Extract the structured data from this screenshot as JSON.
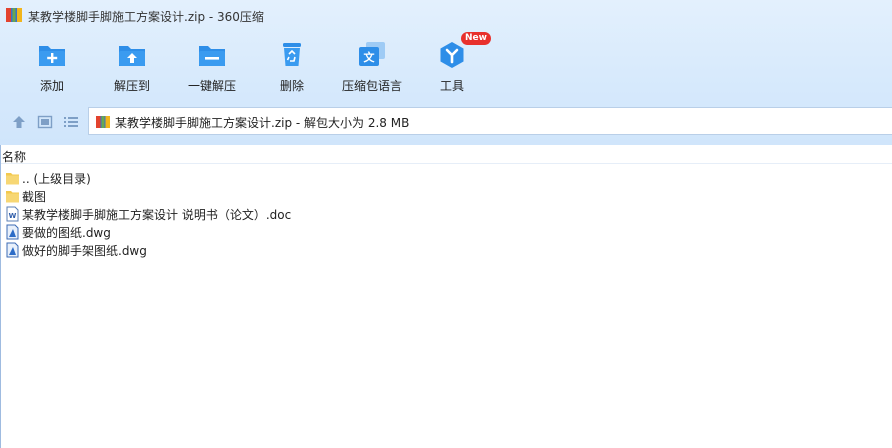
{
  "window": {
    "title": "某教学楼脚手脚施工方案设计.zip - 360压缩"
  },
  "toolbar": {
    "items": [
      {
        "label": "添加",
        "icon": "add-icon"
      },
      {
        "label": "解压到",
        "icon": "extract-to-icon"
      },
      {
        "label": "一键解压",
        "icon": "one-click-extract-icon"
      },
      {
        "label": "删除",
        "icon": "delete-icon"
      },
      {
        "label": "压缩包语言",
        "icon": "language-icon"
      },
      {
        "label": "工具",
        "icon": "tools-icon",
        "badge": "New"
      }
    ]
  },
  "address": {
    "path": "某教学楼脚手脚施工方案设计.zip - 解包大小为 2.8 MB"
  },
  "list": {
    "column_name": "名称",
    "rows": [
      {
        "name": ".. (上级目录)",
        "type": "folder"
      },
      {
        "name": "截图",
        "type": "folder"
      },
      {
        "name": "某教学楼脚手脚施工方案设计 说明书（论文）.doc",
        "type": "doc"
      },
      {
        "name": "要做的图纸.dwg",
        "type": "dwg"
      },
      {
        "name": "做好的脚手架图纸.dwg",
        "type": "dwg"
      }
    ]
  },
  "colors": {
    "accent": "#2e8ee8",
    "toolbar_bg": "#d6e9fc",
    "folder": "#f7d774",
    "badge": "#e8302c"
  }
}
